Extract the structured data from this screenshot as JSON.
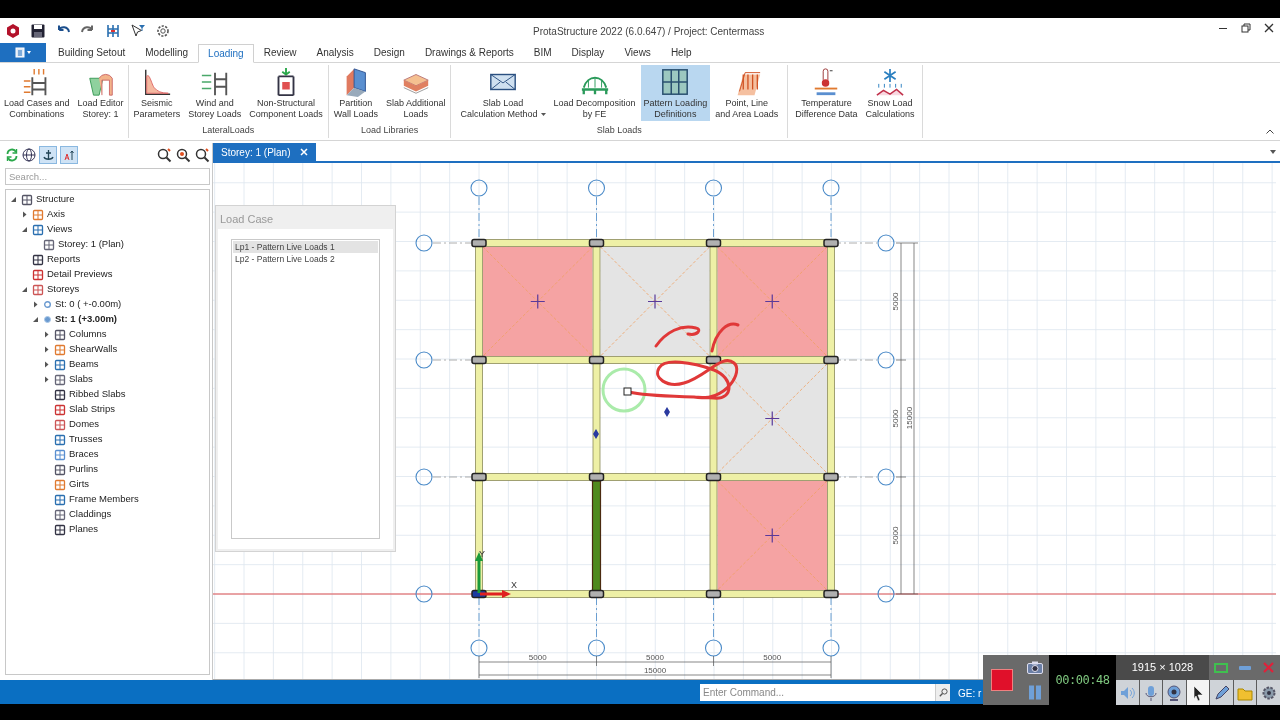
{
  "window": {
    "title": "ProtaStructure 2022 (6.0.647) / Project: Centermass"
  },
  "ribbon_tabs": [
    {
      "label": "Building Setout",
      "selected": false
    },
    {
      "label": "Modelling",
      "selected": false
    },
    {
      "label": "Loading",
      "selected": true
    },
    {
      "label": "Review",
      "selected": false
    },
    {
      "label": "Analysis",
      "selected": false
    },
    {
      "label": "Design",
      "selected": false
    },
    {
      "label": "Drawings & Reports",
      "selected": false
    },
    {
      "label": "BIM",
      "selected": false
    },
    {
      "label": "Display",
      "selected": false
    },
    {
      "label": "Views",
      "selected": false
    },
    {
      "label": "Help",
      "selected": false
    }
  ],
  "ribbon_groups": [
    {
      "buttons": [
        {
          "label": [
            "Load Cases and",
            "Combinations"
          ],
          "selected": false,
          "dropdown": false
        },
        {
          "label": [
            "Load Editor",
            "Storey: 1"
          ],
          "selected": false,
          "dropdown": false
        }
      ]
    },
    {
      "label": "LateralLoads",
      "buttons": [
        {
          "label": [
            "Seismic",
            "Parameters"
          ],
          "selected": false,
          "dropdown": false
        },
        {
          "label": [
            "Wind and",
            "Storey Loads"
          ],
          "selected": false,
          "dropdown": false
        },
        {
          "label": [
            "Non-Structural",
            "Component Loads"
          ],
          "selected": false,
          "dropdown": false
        }
      ]
    },
    {
      "label": "Load Libraries",
      "buttons": [
        {
          "label": [
            "Partition",
            "Wall Loads"
          ],
          "selected": false,
          "dropdown": false
        },
        {
          "label": [
            "Slab Additional",
            "Loads"
          ],
          "selected": false,
          "dropdown": false
        }
      ]
    },
    {
      "label": "Slab Loads",
      "buttons": [
        {
          "label": [
            "Slab Load",
            "Calculation Method"
          ],
          "selected": false,
          "dropdown": true
        },
        {
          "label": [
            "Load Decomposition",
            "by FE"
          ],
          "selected": false,
          "dropdown": false
        },
        {
          "label": [
            "Pattern Loading",
            "Definitions"
          ],
          "selected": true,
          "dropdown": false
        },
        {
          "label": [
            "Point, Line",
            "and Area Loads"
          ],
          "selected": false,
          "dropdown": false
        }
      ]
    },
    {
      "buttons": [
        {
          "label": [
            "Temperature",
            "Difference Data"
          ],
          "selected": false,
          "dropdown": false
        },
        {
          "label": [
            "Snow Load",
            "Calculations"
          ],
          "selected": false,
          "dropdown": false
        }
      ]
    }
  ],
  "sidebar": {
    "search": {
      "placeholder": "Search..."
    },
    "tree": [
      {
        "label": "Structure",
        "expanded": true,
        "children": [
          {
            "label": "Axis",
            "expanded": false
          },
          {
            "label": "Views",
            "expanded": true,
            "children": [
              {
                "label": "Storey: 1 (Plan)"
              }
            ]
          },
          {
            "label": "Reports"
          },
          {
            "label": "Detail Previews"
          },
          {
            "label": "Storeys",
            "expanded": true,
            "children": [
              {
                "label": "St: 0 ( +-0.00m)",
                "expanded": false,
                "active": false
              },
              {
                "label": "St: 1 (+3.00m)",
                "expanded": true,
                "active": true,
                "children": [
                  {
                    "label": "Columns",
                    "expanded": false
                  },
                  {
                    "label": "ShearWalls",
                    "expanded": false
                  },
                  {
                    "label": "Beams",
                    "expanded": false
                  },
                  {
                    "label": "Slabs",
                    "expanded": false
                  },
                  {
                    "label": "Ribbed Slabs"
                  },
                  {
                    "label": "Slab Strips"
                  },
                  {
                    "label": "Domes"
                  },
                  {
                    "label": "Trusses"
                  },
                  {
                    "label": "Braces"
                  },
                  {
                    "label": "Purlins"
                  },
                  {
                    "label": "Girts"
                  },
                  {
                    "label": "Frame Members"
                  },
                  {
                    "label": "Claddings"
                  },
                  {
                    "label": "Planes"
                  }
                ]
              }
            ]
          }
        ]
      }
    ]
  },
  "document_tabs": [
    {
      "label": "Storey: 1 (Plan)",
      "selected": true
    }
  ],
  "load_case_panel": {
    "title": "Load Case",
    "items": [
      {
        "label": "Lp1 - Pattern Live Loads 1",
        "selected": true
      },
      {
        "label": "Lp2 - Pattern Live Loads 2",
        "selected": false
      }
    ]
  },
  "plan": {
    "slabs": [
      {
        "kind": "loaded"
      },
      {
        "kind": "unloaded"
      },
      {
        "kind": "loaded"
      },
      {
        "kind": "empty"
      },
      {
        "kind": "empty"
      },
      {
        "kind": "unloaded"
      },
      {
        "kind": "empty"
      },
      {
        "kind": "empty"
      },
      {
        "kind": "loaded"
      }
    ],
    "axis_labels": {
      "x": "X",
      "y": "Y"
    },
    "bottom_dimensions": [
      "5000",
      "5000",
      "5000"
    ],
    "bottom_total": "15000",
    "right_dimensions": [
      "5000",
      "5000",
      "5000"
    ],
    "right_total": "15000"
  },
  "status_bar": {
    "command": {
      "placeholder": "Enter Command..."
    },
    "text": "GE: r"
  },
  "recorder": {
    "timer": "00:00:48",
    "resolution": "1915 × 1028"
  }
}
